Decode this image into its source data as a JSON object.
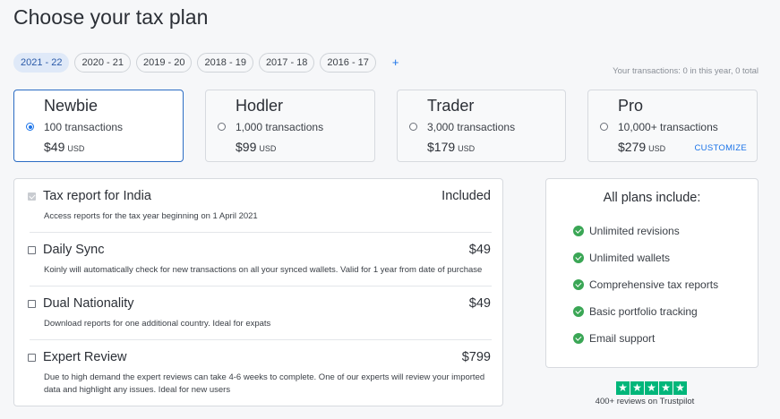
{
  "page": {
    "title": "Choose your tax plan"
  },
  "years": {
    "tabs": [
      "2021 - 22",
      "2020 - 21",
      "2019 - 20",
      "2018 - 19",
      "2017 - 18",
      "2016 - 17"
    ],
    "active_index": 0,
    "add_label": "+"
  },
  "transactions_summary": "Your transactions: 0 in this year, 0 total",
  "plans": [
    {
      "name": "Newbie",
      "transactions": "100 transactions",
      "price": "$49",
      "currency": "USD",
      "selected": true
    },
    {
      "name": "Hodler",
      "transactions": "1,000 transactions",
      "price": "$99",
      "currency": "USD",
      "selected": false
    },
    {
      "name": "Trader",
      "transactions": "3,000 transactions",
      "price": "$179",
      "currency": "USD",
      "selected": false
    },
    {
      "name": "Pro",
      "transactions": "10,000+ transactions",
      "price": "$279",
      "currency": "USD",
      "selected": false,
      "customize_label": "CUSTOMIZE"
    }
  ],
  "addons": [
    {
      "title": "Tax report for India",
      "price": "Included",
      "description": "Access reports for the tax year beginning on 1 April 2021",
      "checked": true,
      "disabled": true
    },
    {
      "title": "Daily Sync",
      "price": "$49",
      "description": "Koinly will automatically check for new transactions on all your synced wallets. Valid for 1 year from date of purchase",
      "checked": false,
      "disabled": false
    },
    {
      "title": "Dual Nationality",
      "price": "$49",
      "description": "Download reports for one additional country. Ideal for expats",
      "checked": false,
      "disabled": false
    },
    {
      "title": "Expert Review",
      "price": "$799",
      "description": "Due to high demand the expert reviews can take 4-6 weeks to complete. One of our experts will review your imported data and highlight any issues. Ideal for new users",
      "checked": false,
      "disabled": false
    }
  ],
  "includes": {
    "title": "All plans include:",
    "items": [
      "Unlimited revisions",
      "Unlimited wallets",
      "Comprehensive tax reports",
      "Basic portfolio tracking",
      "Email support"
    ]
  },
  "trustpilot": {
    "stars": 5,
    "text": "400+ reviews on Trustpilot",
    "color": "#00b67a"
  },
  "colors": {
    "accent": "#1a73e8",
    "success": "#3aa655"
  }
}
